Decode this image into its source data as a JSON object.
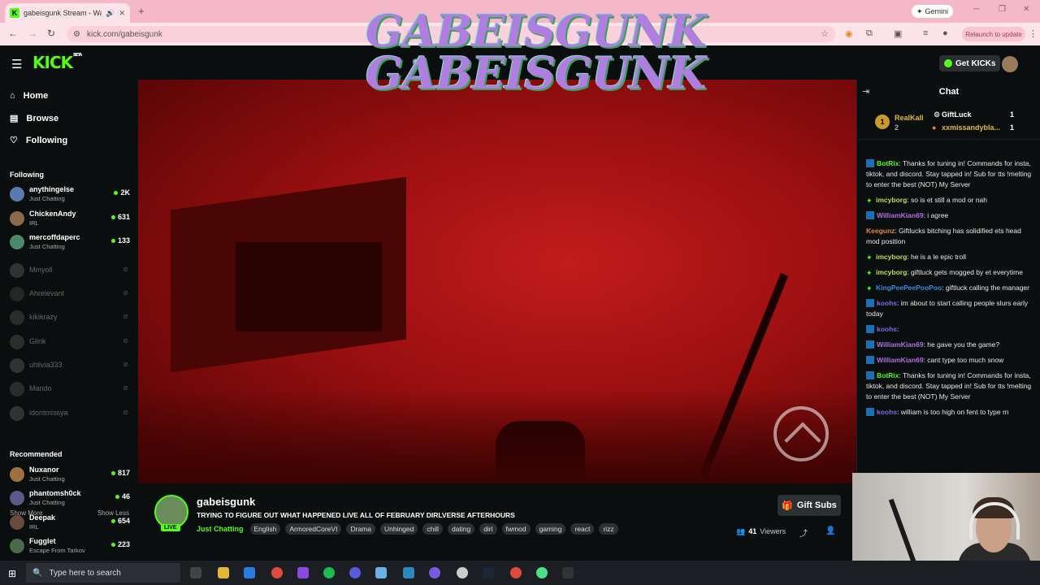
{
  "browser": {
    "tab_title": "gabeisgunk Stream - Watch",
    "tab_favicon": "K",
    "new_tab": "+",
    "gemini_label": "Gemini",
    "url": "kick.com/gabeisgunk",
    "relaunch": "Relaunch to update"
  },
  "kick": {
    "logo": "KICK",
    "logo_beta": "BETA",
    "get_kicks": "Get KICKs",
    "overlay_text": "GABEISGUNK GABEISGUNK"
  },
  "sidebar": {
    "nav": [
      {
        "label": "Home",
        "icon": "home-icon"
      },
      {
        "label": "Browse",
        "icon": "browse-icon"
      },
      {
        "label": "Following",
        "icon": "heart-icon"
      }
    ],
    "following_title": "Following",
    "following": [
      {
        "name": "anythingelse",
        "category": "Just Chatting",
        "viewers": "2K",
        "live": true,
        "color": "#5a7ab0"
      },
      {
        "name": "ChickenAndy",
        "category": "IRL",
        "viewers": "631",
        "live": true,
        "color": "#8a6a4a"
      },
      {
        "name": "mercoffdaperc",
        "category": "Just Chatting",
        "viewers": "133",
        "live": true,
        "color": "#4a8a6a"
      },
      {
        "name": "Mmyoll",
        "live": false,
        "color": "#777"
      },
      {
        "name": "Ahrelevant",
        "live": false,
        "color": "#555"
      },
      {
        "name": "kikikrazy",
        "live": false,
        "color": "#666"
      },
      {
        "name": "Glink",
        "live": false,
        "color": "#6a6a6a"
      },
      {
        "name": "uhlivia333",
        "live": false,
        "color": "#777"
      },
      {
        "name": "Mando",
        "live": false,
        "color": "#666"
      },
      {
        "name": "idontmissya",
        "live": false,
        "color": "#777"
      }
    ],
    "show_more": "Show More",
    "show_less": "Show Less",
    "recommended_title": "Recommended",
    "recommended": [
      {
        "name": "Nuxanor",
        "category": "Just Chatting",
        "viewers": "817",
        "color": "#a07040"
      },
      {
        "name": "phantomsh0ck",
        "category": "Just Chatting",
        "viewers": "46",
        "color": "#5a5a8a"
      },
      {
        "name": "Deepak",
        "category": "IRL",
        "viewers": "654",
        "color": "#6a4a3a"
      },
      {
        "name": "Fugglet",
        "category": "Escape From Tarkov",
        "viewers": "223",
        "color": "#4a6a4a"
      }
    ]
  },
  "stream": {
    "streamer": "gabeisgunk",
    "live_badge": "LIVE",
    "title": "TRYING TO FIGURE OUT WHAT HAPPENED  LIVE ALL OF FEBRUARY DIRLVERSE AFTERHOURS",
    "category": "Just Chatting",
    "tags": [
      "English",
      "ArmoredCoreVI",
      "Drama",
      "Unhinged",
      "chill",
      "dating",
      "dirl",
      "fwmod",
      "gaming",
      "react",
      "rizz"
    ],
    "gift_subs": "Gift Subs",
    "viewer_count": "41",
    "viewers_label": "Viewers"
  },
  "chat": {
    "title": "Chat",
    "leaderboard": [
      {
        "rank": "1",
        "name": "RealKall",
        "count": "2"
      },
      {
        "name": "GiftLuck",
        "count": "1"
      },
      {
        "name": "xxmissandybla...",
        "count": "1"
      }
    ],
    "messages": [
      {
        "user": "BotRix",
        "color": "#53fc18",
        "text": ": Thanks for tuning in! Commands for insta, tiktok, and discord. Stay tapped in! Sub for tts !melting to enter the best (NOT) My Server",
        "badge": "bot"
      },
      {
        "user": "imcyborg",
        "color": "#b7e04a",
        "text": ": so is et still a mod or nah",
        "badge": "star"
      },
      {
        "user": "WilliamKian69",
        "color": "#b06ee0",
        "text": ": i agree",
        "badge": "bot"
      },
      {
        "user": "Keegunz",
        "color": "#e0883a",
        "text": ": Giftlucks bitching has solidified ets head mod position",
        "badge": ""
      },
      {
        "user": "imcyborg",
        "color": "#b7e04a",
        "text": ": he is a le epic troll",
        "badge": "star"
      },
      {
        "user": "imcyborg",
        "color": "#b7e04a",
        "text": ": giftluck gets mogged by et everytime",
        "badge": "star"
      },
      {
        "user": "KingPeePeePooPoo",
        "color": "#3a8ae0",
        "text": ": giftluck calling the manager",
        "badge": "star"
      },
      {
        "user": "koohs",
        "color": "#7a6ae0",
        "text": ": im about to start calling people slurs early today",
        "badge": "bot"
      },
      {
        "user": "koohs",
        "color": "#7a6ae0",
        "text": ":",
        "badge": "bot"
      },
      {
        "user": "WilliamKian69",
        "color": "#b06ee0",
        "text": ": he gave you the game?",
        "badge": "bot"
      },
      {
        "user": "WilliamKian69",
        "color": "#b06ee0",
        "text": ": cant type too much snow",
        "badge": "bot"
      },
      {
        "user": "BotRix",
        "color": "#53fc18",
        "text": ": Thanks for tuning in! Commands for insta, tiktok, and discord. Stay tapped in! Sub for tts !melting to enter the best (NOT) My Server",
        "badge": "bot"
      },
      {
        "user": "koohs",
        "color": "#7a6ae0",
        "text": ": william is too high on fent to type rn",
        "badge": "bot"
      }
    ]
  },
  "taskbar": {
    "search_placeholder": "Type here to search"
  },
  "colors": {
    "accent": "#53fc18",
    "bg": "#0b0e0f",
    "browser_tab": "#f5b8c9"
  }
}
